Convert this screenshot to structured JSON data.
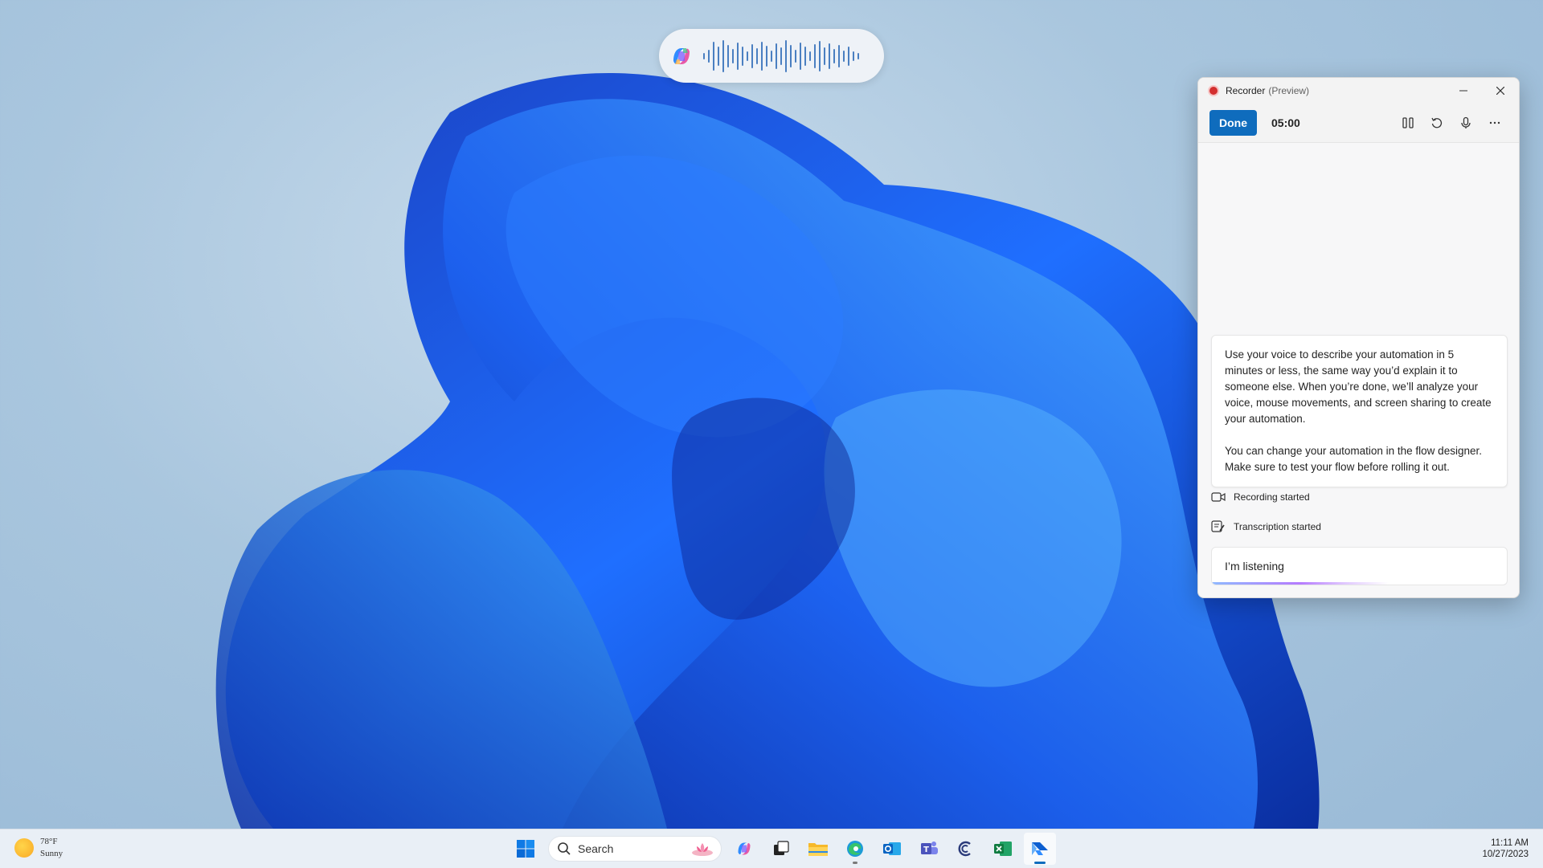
{
  "voice_overlay": {
    "logo_icon": "copilot-icon",
    "waveform_icon": "voice-waveform-icon"
  },
  "recorder": {
    "title": "Recorder",
    "title_suffix": "(Preview)",
    "done_label": "Done",
    "timer": "05:00",
    "toolbar_icons": [
      "pause-icon",
      "restart-icon",
      "microphone-icon",
      "more-icon"
    ],
    "info_paragraphs": [
      "Use your voice to describe your automation in 5 minutes or less, the same way you’d explain it to someone else. When you’re done, we’ll analyze your voice, mouse movements, and screen sharing to create your automation.",
      "You can change your automation in the flow designer. Make sure to test your flow before rolling it out."
    ],
    "status_items": [
      {
        "icon": "video-camera-icon",
        "label": "Recording started"
      },
      {
        "icon": "transcript-icon",
        "label": "Transcription started"
      }
    ],
    "listening_label": "I’m listening"
  },
  "taskbar": {
    "weather": {
      "temp": "78°F",
      "condition": "Sunny"
    },
    "search_placeholder": "Search",
    "apps": [
      "windows-start-icon",
      "copilot-icon",
      "task-view-icon",
      "file-explorer-icon",
      "edge-icon",
      "outlook-icon",
      "teams-icon",
      "copilot-app-icon",
      "excel-icon",
      "power-automate-icon"
    ],
    "clock": {
      "time": "11:11 AM",
      "date": "10/27/2023"
    }
  },
  "colors": {
    "accent": "#0f6cbd",
    "record_red": "#d32f2f"
  }
}
